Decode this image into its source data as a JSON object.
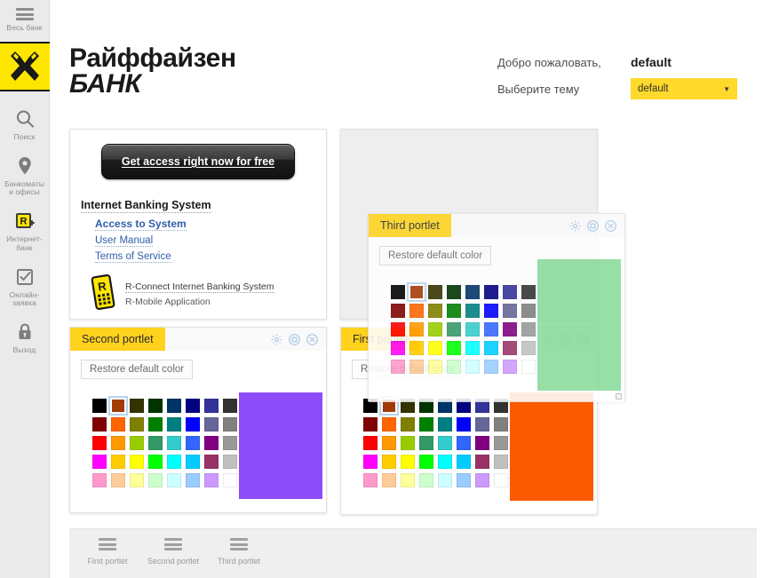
{
  "sidebar": {
    "items": [
      {
        "label": "Весь банк",
        "icon": "hamburger-icon"
      },
      {
        "label": "Поиск",
        "icon": "search-icon"
      },
      {
        "label": "Банкоматы\nи офисы",
        "icon": "map-pin-icon"
      },
      {
        "label": "Интернет-\nбанк",
        "icon": "r-connect-icon"
      },
      {
        "label": "Онлайн-\nзаявка",
        "icon": "checkbox-icon"
      },
      {
        "label": "Выход",
        "icon": "lock-icon"
      }
    ],
    "logo_alt": "raiffeisen-logo"
  },
  "brand": {
    "line1": "Райффайзен",
    "line2": "БАНК"
  },
  "header": {
    "welcome_label": "Добро пожаловать,",
    "welcome_user": "default",
    "theme_label": "Выберите тему",
    "theme_value": "default",
    "theme_options": [
      "default"
    ]
  },
  "content_card": {
    "cta_label": "Get access right now for free",
    "section_title": "Internet Banking System",
    "links": [
      "Access to System",
      "User Manual",
      "Terms of Service"
    ],
    "mobile_link": "R-Connect Internet Banking System",
    "mobile_text": "R-Mobile Application"
  },
  "portlets": {
    "first": {
      "title": "First portlet",
      "restore_label": "Restore default color",
      "swatch_color": "#fc5a00"
    },
    "second": {
      "title": "Second portlet",
      "restore_label": "Restore default color",
      "swatch_color": "#8c4df8"
    },
    "third": {
      "title": "Third portlet",
      "restore_label": "Restore default color",
      "swatch_color": "#68d17f"
    },
    "tools": [
      "gear-icon",
      "maximize-icon",
      "close-icon"
    ]
  },
  "palette": {
    "selected_index": 1,
    "rows": [
      [
        "#000000",
        "#a33b06",
        "#333300",
        "#003300",
        "#003366",
        "#000080",
        "#333399",
        "#333333"
      ],
      [
        "#800000",
        "#ff6600",
        "#808000",
        "#008000",
        "#008080",
        "#0000ff",
        "#666699",
        "#808080"
      ],
      [
        "#ff0000",
        "#ff9900",
        "#99cc00",
        "#339966",
        "#33cccc",
        "#3366ff",
        "#800080",
        "#999999"
      ],
      [
        "#ff00ff",
        "#ffcc00",
        "#ffff00",
        "#00ff00",
        "#00ffff",
        "#00ccff",
        "#993366",
        "#c0c0c0"
      ],
      [
        "#ff99cc",
        "#ffcc99",
        "#ffff99",
        "#ccffcc",
        "#ccffff",
        "#99ccff",
        "#cc99ff",
        "#ffffff"
      ]
    ]
  },
  "bottom_bar": {
    "items": [
      {
        "label": "First portlet",
        "icon": "hamburger-icon"
      },
      {
        "label": "Second portlet",
        "icon": "hamburger-icon"
      },
      {
        "label": "Third portlet",
        "icon": "hamburger-icon"
      }
    ]
  },
  "colors": {
    "brand_yellow": "#ffe600",
    "portlet_title_yellow": "#ffd21e",
    "select_yellow": "#ffd92b",
    "sidebar_bg": "#eaeaea"
  }
}
